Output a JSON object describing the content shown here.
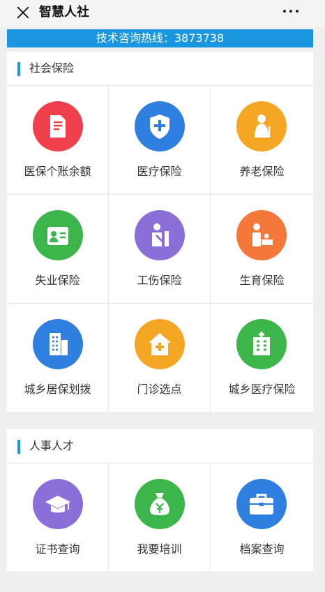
{
  "header": {
    "title": "智慧人社"
  },
  "hotline": "技术咨询热线：3873738",
  "sections": [
    {
      "title": "社会保险",
      "items": [
        {
          "label": "医保个账余额",
          "color": "#f0404e",
          "icon": "document-icon"
        },
        {
          "label": "医疗保险",
          "color": "#2f7fe0",
          "icon": "medical-shield-icon"
        },
        {
          "label": "养老保险",
          "color": "#f5a623",
          "icon": "elderly-icon"
        },
        {
          "label": "失业保险",
          "color": "#3cb54a",
          "icon": "id-badge-icon"
        },
        {
          "label": "工伤保险",
          "color": "#8a6fd8",
          "icon": "injured-person-icon"
        },
        {
          "label": "生育保险",
          "color": "#f5773a",
          "icon": "parent-baby-icon"
        },
        {
          "label": "城乡居保划拨",
          "color": "#2f7fe0",
          "icon": "building-icon"
        },
        {
          "label": "门诊选点",
          "color": "#f5a623",
          "icon": "clinic-icon"
        },
        {
          "label": "城乡医疗保险",
          "color": "#3cb54a",
          "icon": "hospital-icon"
        }
      ]
    },
    {
      "title": "人事人才",
      "items": [
        {
          "label": "证书查询",
          "color": "#8a6fd8",
          "icon": "graduation-cap-icon"
        },
        {
          "label": "我要培训",
          "color": "#3cb54a",
          "icon": "money-bag-icon"
        },
        {
          "label": "档案查询",
          "color": "#2f7fe0",
          "icon": "briefcase-icon"
        }
      ]
    }
  ]
}
